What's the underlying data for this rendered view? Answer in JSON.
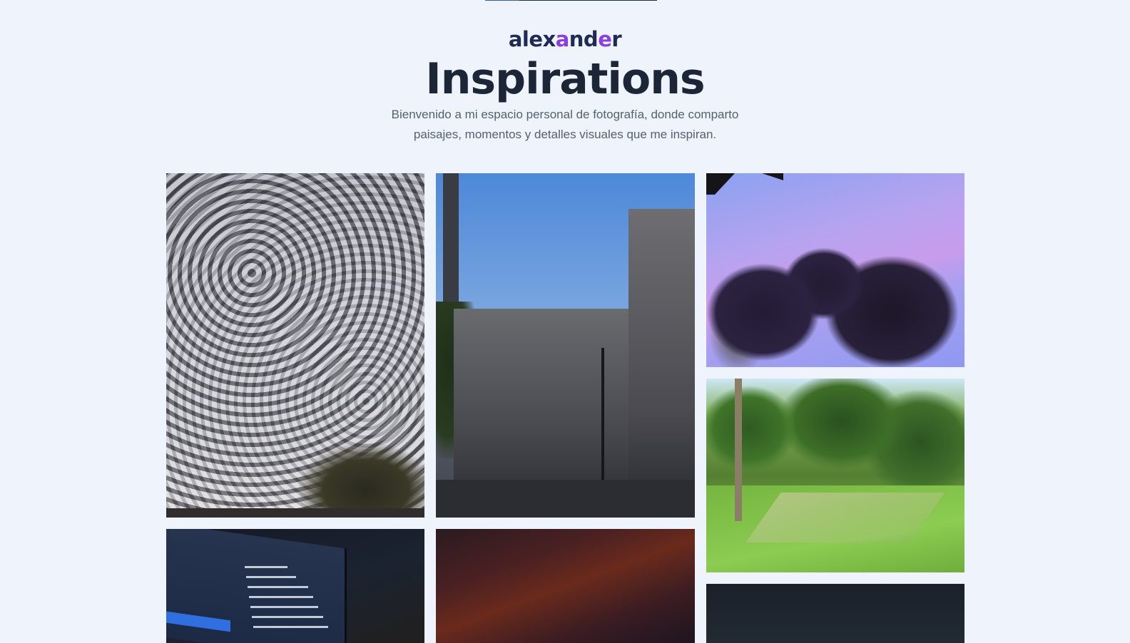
{
  "brand": {
    "logo_part1": "al",
    "logo_part2": "ex",
    "logo_part3": "a",
    "logo_part4": "nd",
    "logo_part5": "e",
    "logo_part6": "r",
    "accent": "#8b3fe0",
    "primary": "#1f2b56"
  },
  "header": {
    "title": "Inspirations",
    "subtitle_line1": "Bienvenido a mi espacio personal de fotografía, donde comparto",
    "subtitle_line2": "paisajes, momentos y detalles visuales que me inspiran."
  },
  "gallery": {
    "photos": [
      {
        "name": "cloudy-sky-photo"
      },
      {
        "name": "colonial-building-street-photo"
      },
      {
        "name": "purple-sky-trees-photo"
      },
      {
        "name": "garden-lawn-photo"
      },
      {
        "name": "laptop-console-code-photo"
      },
      {
        "name": "red-sunset-sky-photo"
      },
      {
        "name": "dark-night-sky-photo"
      }
    ]
  },
  "colors": {
    "background": "#eff3fb",
    "title": "#1c2636",
    "subtitle": "#566071"
  }
}
